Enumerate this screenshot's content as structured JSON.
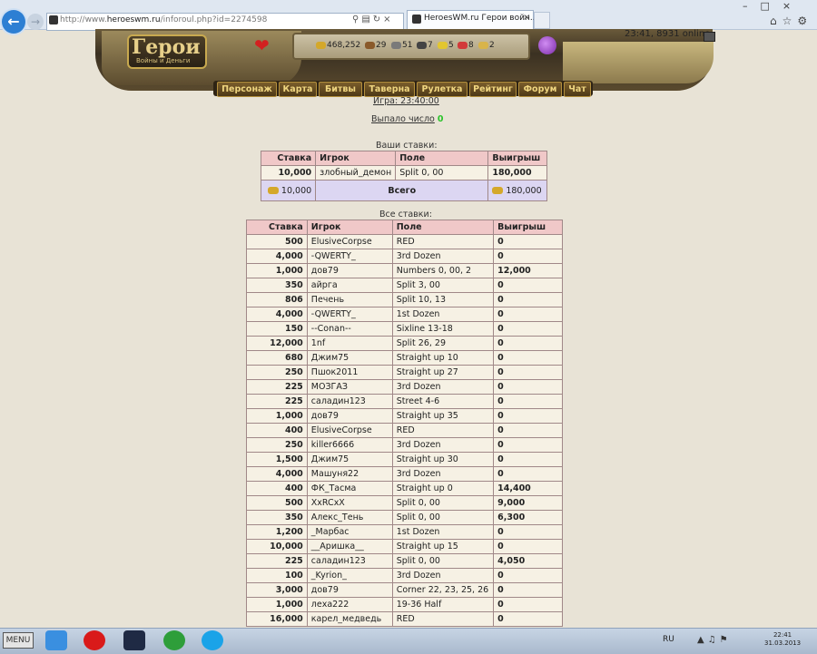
{
  "browser": {
    "url_prefix": "http://www.",
    "url_domain": "heroeswm.ru",
    "url_path": "/inforoul.php?id=2274598",
    "tab_title": "HeroesWM.ru Герои войн..."
  },
  "header": {
    "logo_title": "Герои",
    "logo_subtitle": "Войны и Деньги",
    "resources": [
      "468,252",
      "29",
      "51",
      "7",
      "5",
      "8",
      "2"
    ],
    "time_online": "23:41, 8931 online",
    "nav": [
      "Персонаж",
      "Карта",
      "Битвы",
      "Таверна",
      "Рулетка",
      "Рейтинг",
      "Форум",
      "Чат"
    ]
  },
  "game": {
    "game_time": "Игра: 23:40:00",
    "result_label": "Выпало число",
    "result_number": "0"
  },
  "my_bets": {
    "caption": "Ваши ставки:",
    "headers": [
      "Ставка",
      "Игрок",
      "Поле",
      "Выигрыш"
    ],
    "rows": [
      [
        "10,000",
        "злобный_демон",
        "Split 0, 00",
        "180,000"
      ]
    ],
    "total_bet": "10,000",
    "total_label": "Всего",
    "total_win": "180,000"
  },
  "all_bets": {
    "caption": "Все ставки:",
    "headers": [
      "Ставка",
      "Игрок",
      "Поле",
      "Выигрыш"
    ],
    "rows": [
      [
        "500",
        "ElusiveCorpse",
        "RED",
        "0"
      ],
      [
        "4,000",
        "-QWERTY_",
        "3rd Dozen",
        "0"
      ],
      [
        "1,000",
        "дов79",
        "Numbers 0, 00, 2",
        "12,000"
      ],
      [
        "350",
        "айрга",
        "Split 3, 00",
        "0"
      ],
      [
        "806",
        "Печень",
        "Split 10, 13",
        "0"
      ],
      [
        "4,000",
        "-QWERTY_",
        "1st Dozen",
        "0"
      ],
      [
        "150",
        "--Conan--",
        "Sixline 13-18",
        "0"
      ],
      [
        "12,000",
        "1nf",
        "Split 26, 29",
        "0"
      ],
      [
        "680",
        "Джим75",
        "Straight up 10",
        "0"
      ],
      [
        "250",
        "Пшок2011",
        "Straight up 27",
        "0"
      ],
      [
        "225",
        "МОЗГАЗ",
        "3rd Dozen",
        "0"
      ],
      [
        "225",
        "саладин123",
        "Street 4-6",
        "0"
      ],
      [
        "1,000",
        "дов79",
        "Straight up 35",
        "0"
      ],
      [
        "400",
        "ElusiveCorpse",
        "RED",
        "0"
      ],
      [
        "250",
        "killer6666",
        "3rd Dozen",
        "0"
      ],
      [
        "1,500",
        "Джим75",
        "Straight up 30",
        "0"
      ],
      [
        "4,000",
        "Машуня22",
        "3rd Dozen",
        "0"
      ],
      [
        "400",
        "ФК_Тасма",
        "Straight up 0",
        "14,400"
      ],
      [
        "500",
        "XxRCxX",
        "Split 0, 00",
        "9,000"
      ],
      [
        "350",
        "Алекс_Тень",
        "Split 0, 00",
        "6,300"
      ],
      [
        "1,200",
        "_Марбас",
        "1st Dozen",
        "0"
      ],
      [
        "10,000",
        "__Аришка__",
        "Straight up 15",
        "0"
      ],
      [
        "225",
        "саладин123",
        "Split 0, 00",
        "4,050"
      ],
      [
        "100",
        "_Kyrion_",
        "3rd Dozen",
        "0"
      ],
      [
        "3,000",
        "дов79",
        "Corner 22, 23, 25, 26",
        "0"
      ],
      [
        "1,000",
        "леха222",
        "19-36 Half",
        "0"
      ],
      [
        "16,000",
        "карел_медведь",
        "RED",
        "0"
      ]
    ]
  },
  "taskbar": {
    "menu_label": "MENU",
    "lang": "RU",
    "time": "22:41",
    "date": "31.03.2013"
  }
}
